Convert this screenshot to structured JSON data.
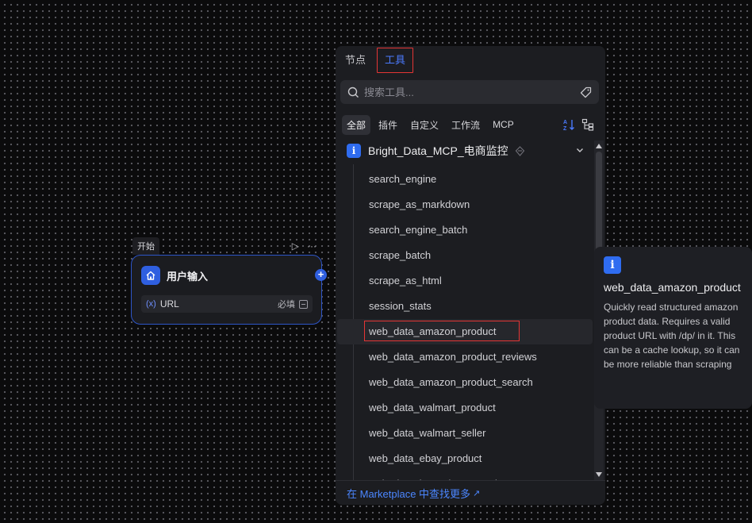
{
  "start_node": {
    "tag": "开始",
    "title": "用户输入",
    "field": {
      "var_prefix": "(x)",
      "name": "URL",
      "required": "必填"
    }
  },
  "panel": {
    "tabs": [
      {
        "label": "节点"
      },
      {
        "label": "工具"
      }
    ],
    "search": {
      "placeholder": "搜索工具..."
    },
    "filters": [
      {
        "label": "全部"
      },
      {
        "label": "插件"
      },
      {
        "label": "自定义"
      },
      {
        "label": "工作流"
      },
      {
        "label": "MCP"
      }
    ],
    "group": {
      "name": "Bright_Data_MCP_电商监控",
      "badge": "i"
    },
    "tools": [
      {
        "label": "search_engine"
      },
      {
        "label": "scrape_as_markdown"
      },
      {
        "label": "search_engine_batch"
      },
      {
        "label": "scrape_batch"
      },
      {
        "label": "scrape_as_html"
      },
      {
        "label": "session_stats"
      },
      {
        "label": "web_data_amazon_product"
      },
      {
        "label": "web_data_amazon_product_reviews"
      },
      {
        "label": "web_data_amazon_product_search"
      },
      {
        "label": "web_data_walmart_product"
      },
      {
        "label": "web_data_walmart_seller"
      },
      {
        "label": "web_data_ebay_product"
      },
      {
        "label": "web_data_homedepot_products"
      }
    ],
    "marketplace_link": "在 Marketplace 中查找更多",
    "marketplace_arrow": "↗"
  },
  "tooltip": {
    "badge": "i",
    "title": "web_data_amazon_product",
    "description": "Quickly read structured amazon product data. Requires a valid product URL with /dp/ in it. This can be a cache lookup, so it can be more reliable than scraping"
  },
  "colors": {
    "accent": "#4b7bff",
    "highlight": "#e53535",
    "node_border": "#2d55c8"
  }
}
